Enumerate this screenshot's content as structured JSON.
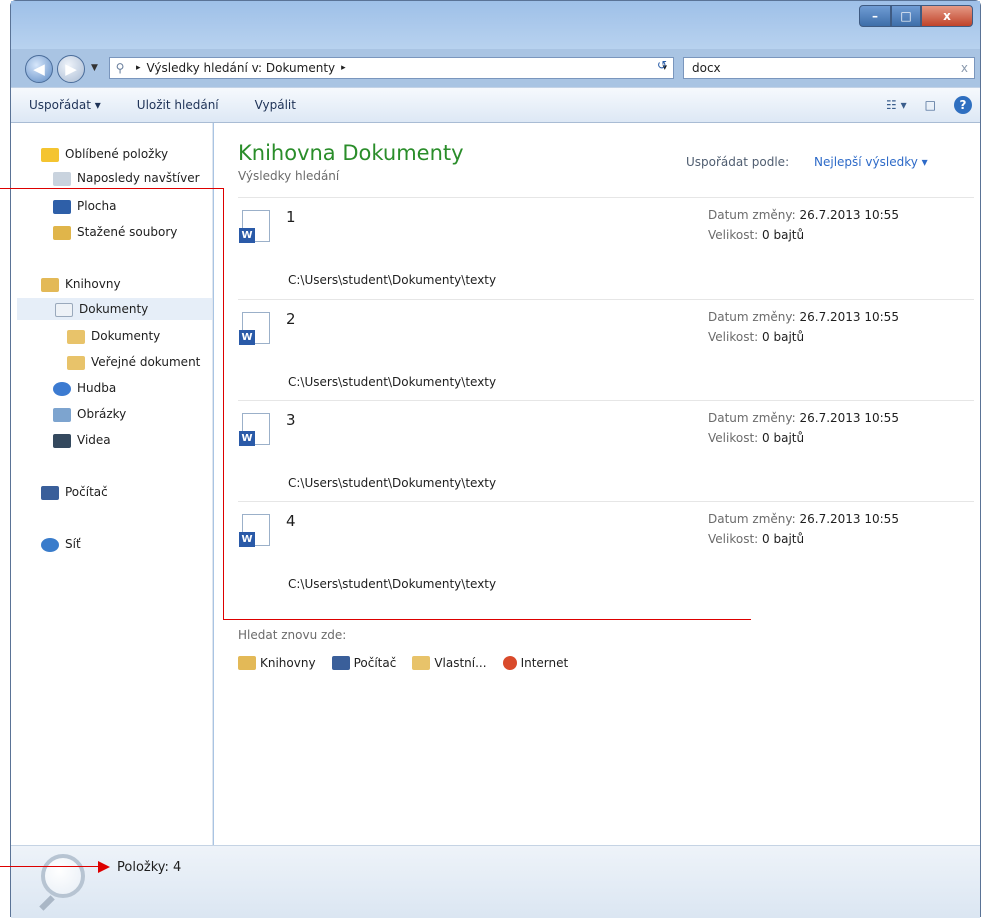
{
  "window": {
    "min": "–",
    "max": "□",
    "close": "x"
  },
  "nav": {
    "back": "◀",
    "forward": "▶",
    "dropdown": "▼"
  },
  "address": {
    "sep": "▸",
    "crumb": "Výsledky hledání v: Dokumenty",
    "sep2": "▸",
    "dropdown": "▾"
  },
  "refresh": "↺",
  "search": {
    "value": "docx",
    "clear": "x"
  },
  "toolbar": {
    "organize": "Uspořádat ▾",
    "save_search": "Uložit hledání",
    "burn": "Vypálit",
    "view_icon": "☷ ▾",
    "preview_icon": "□",
    "help": "?"
  },
  "sidebar": {
    "items": [
      {
        "label": "Oblíbené položky",
        "icon": "star-icon"
      },
      {
        "label": "Naposledy navštíver",
        "icon": "recent-places-icon"
      },
      {
        "label": "Plocha",
        "icon": "desktop-icon"
      },
      {
        "label": "Stažené soubory",
        "icon": "downloads-icon"
      },
      {
        "label": "Knihovny",
        "icon": "libraries-icon"
      },
      {
        "label": "Dokumenty",
        "icon": "documents-icon"
      },
      {
        "label": "Dokumenty",
        "icon": "folder-icon"
      },
      {
        "label": "Veřejné dokument",
        "icon": "folder-icon"
      },
      {
        "label": "Hudba",
        "icon": "music-icon"
      },
      {
        "label": "Obrázky",
        "icon": "pictures-icon"
      },
      {
        "label": "Videa",
        "icon": "videos-icon"
      },
      {
        "label": "Počítač",
        "icon": "computer-icon"
      },
      {
        "label": "Síť",
        "icon": "network-icon"
      }
    ]
  },
  "main": {
    "title": "Knihovna Dokumenty",
    "subtitle": "Výsledky hledání",
    "arrange_label": "Uspořádat podle:",
    "arrange_value": "Nejlepší výsledky ▾",
    "results": [
      {
        "name": "1",
        "path": "C:\\Users\\student\\Dokumenty\\texty",
        "date_label": "Datum změny:",
        "date": "26.7.2013 10:55",
        "size_label": "Velikost:",
        "size": "0 bajtů"
      },
      {
        "name": "2",
        "path": "C:\\Users\\student\\Dokumenty\\texty",
        "date_label": "Datum změny:",
        "date": "26.7.2013 10:55",
        "size_label": "Velikost:",
        "size": "0 bajtů"
      },
      {
        "name": "3",
        "path": "C:\\Users\\student\\Dokumenty\\texty",
        "date_label": "Datum změny:",
        "date": "26.7.2013 10:55",
        "size_label": "Velikost:",
        "size": "0 bajtů"
      },
      {
        "name": "4",
        "path": "C:\\Users\\student\\Dokumenty\\texty",
        "date_label": "Datum změny:",
        "date": "26.7.2013 10:55",
        "size_label": "Velikost:",
        "size": "0 bajtů"
      }
    ],
    "search_again_label": "Hledat znovu zde:",
    "search_again": [
      {
        "label": "Knihovny",
        "icon": "libraries-icon"
      },
      {
        "label": "Počítač",
        "icon": "computer-icon"
      },
      {
        "label": "Vlastní...",
        "icon": "custom-icon"
      },
      {
        "label": "Internet",
        "icon": "internet-icon"
      }
    ]
  },
  "status": {
    "count": "Položky: 4"
  }
}
